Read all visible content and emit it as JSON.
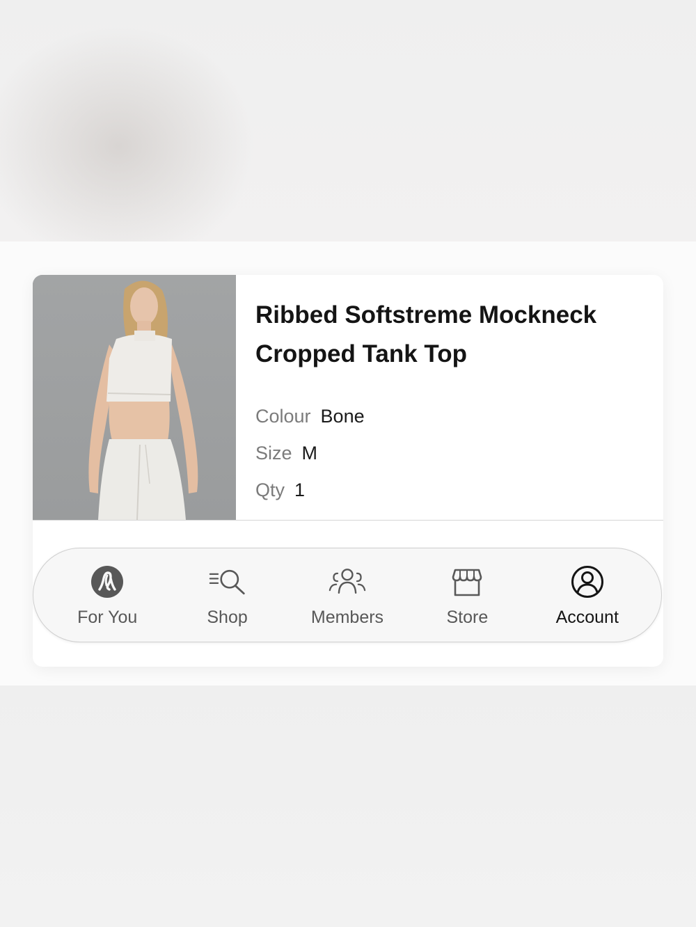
{
  "product": {
    "title": "Ribbed Softstreme Mockneck Cropped Tank Top",
    "colour_label": "Colour",
    "colour_value": "Bone",
    "size_label": "Size",
    "size_value": "M",
    "qty_label": "Qty",
    "qty_value": "1"
  },
  "nav": {
    "items": [
      {
        "label": "For You",
        "icon": "lululemon-logo-icon",
        "active": false
      },
      {
        "label": "Shop",
        "icon": "shop-search-icon",
        "active": false
      },
      {
        "label": "Members",
        "icon": "members-icon",
        "active": false
      },
      {
        "label": "Store",
        "icon": "store-icon",
        "active": false
      },
      {
        "label": "Account",
        "icon": "account-icon",
        "active": true
      }
    ]
  },
  "colors": {
    "nav_inactive": "#585858",
    "nav_active": "#151515",
    "label_grey": "#7b7b7b"
  }
}
